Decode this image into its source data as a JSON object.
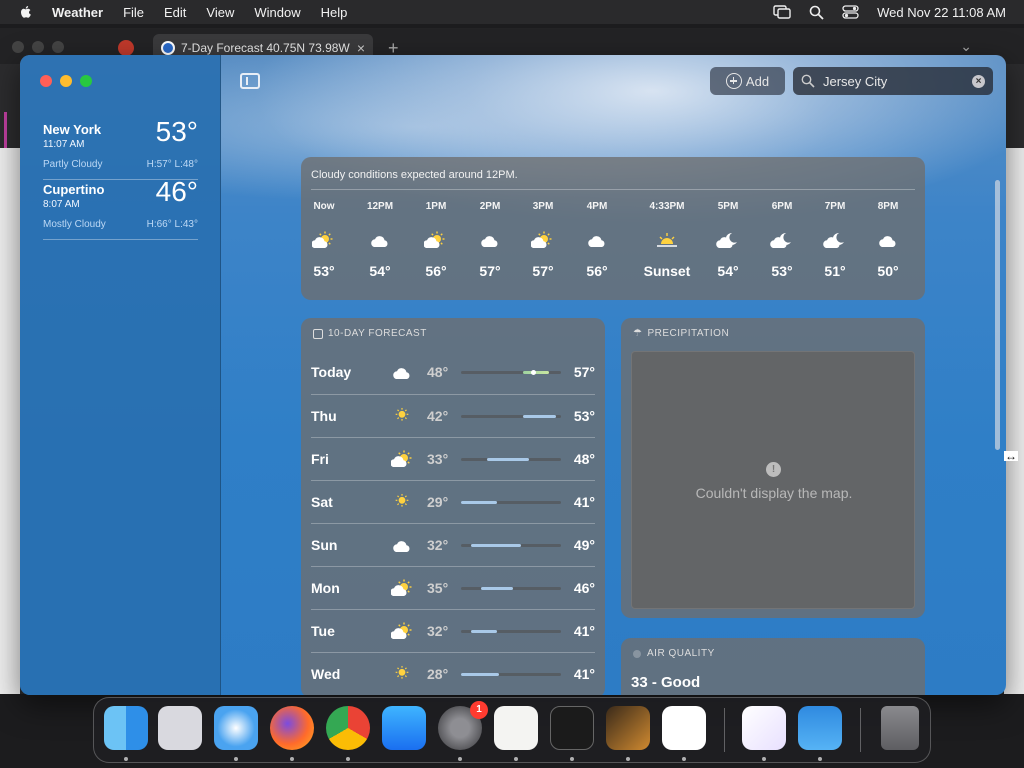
{
  "menubar": {
    "app_name": "Weather",
    "menus": [
      "File",
      "Edit",
      "View",
      "Window",
      "Help"
    ],
    "datetime": "Wed Nov 22  11:08 AM"
  },
  "browser": {
    "tab_title": "7-Day Forecast 40.75N 73.98W"
  },
  "sidebar": {
    "locations": [
      {
        "name": "New York",
        "time": "11:07 AM",
        "temp": "53°",
        "condition": "Partly Cloudy",
        "hilo": "H:57°  L:48°"
      },
      {
        "name": "Cupertino",
        "time": "8:07 AM",
        "temp": "46°",
        "condition": "Mostly Cloudy",
        "hilo": "H:66°  L:43°"
      }
    ]
  },
  "toolbar": {
    "add_label": "Add",
    "search_value": "Jersey City"
  },
  "hourly": {
    "summary": "Cloudy conditions expected around 12PM.",
    "hours": [
      {
        "label": "Now",
        "icon": "partly-sunny-icon",
        "temp": "53°"
      },
      {
        "label": "12PM",
        "icon": "cloud-icon",
        "temp": "54°"
      },
      {
        "label": "1PM",
        "icon": "partly-sunny-icon",
        "temp": "56°"
      },
      {
        "label": "2PM",
        "icon": "cloud-icon",
        "temp": "57°"
      },
      {
        "label": "3PM",
        "icon": "partly-sunny-icon",
        "temp": "57°"
      },
      {
        "label": "4PM",
        "icon": "cloud-icon",
        "temp": "56°"
      },
      {
        "label": "4:33PM",
        "icon": "sunset-icon",
        "temp": "Sunset"
      },
      {
        "label": "5PM",
        "icon": "partly-cloudy-night-icon",
        "temp": "54°"
      },
      {
        "label": "6PM",
        "icon": "partly-cloudy-night-icon",
        "temp": "53°"
      },
      {
        "label": "7PM",
        "icon": "partly-cloudy-night-icon",
        "temp": "51°"
      },
      {
        "label": "8PM",
        "icon": "cloud-icon",
        "temp": "50°"
      }
    ]
  },
  "tenday": {
    "title": "10-DAY FORECAST",
    "days": [
      {
        "day": "Today",
        "icon": "cloud-icon",
        "low": "48°",
        "high": "57°",
        "range_start": 0.62,
        "range_end": 0.88
      },
      {
        "day": "Thu",
        "icon": "sun-icon",
        "low": "42°",
        "high": "53°",
        "range_start": 0.62,
        "range_end": 0.95
      },
      {
        "day": "Fri",
        "icon": "partly-sunny-icon",
        "low": "33°",
        "high": "48°",
        "range_start": 0.26,
        "range_end": 0.68
      },
      {
        "day": "Sat",
        "icon": "sun-icon",
        "low": "29°",
        "high": "41°",
        "range_start": 0.0,
        "range_end": 0.36
      },
      {
        "day": "Sun",
        "icon": "cloud-icon",
        "low": "32°",
        "high": "49°",
        "range_start": 0.1,
        "range_end": 0.6
      },
      {
        "day": "Mon",
        "icon": "partly-sunny-icon",
        "low": "35°",
        "high": "46°",
        "range_start": 0.2,
        "range_end": 0.52
      },
      {
        "day": "Tue",
        "icon": "partly-sunny-icon",
        "low": "32°",
        "high": "41°",
        "range_start": 0.1,
        "range_end": 0.36
      },
      {
        "day": "Wed",
        "icon": "sun-icon",
        "low": "28°",
        "high": "41°",
        "range_start": 0.0,
        "range_end": 0.38
      }
    ]
  },
  "precipitation": {
    "title": "PRECIPITATION",
    "message": "Couldn't display the map."
  },
  "air_quality": {
    "title": "AIR QUALITY",
    "value": "33 - Good"
  },
  "dock": {
    "apps": [
      "Finder",
      "Launchpad",
      "Safari",
      "Firefox",
      "Chrome",
      "App Store",
      "System Settings",
      "TextEdit",
      "Terminal",
      "GarageBand",
      "VS Code",
      "Visual Studio",
      "Weather",
      "Trash"
    ],
    "settings_badge": "1"
  }
}
